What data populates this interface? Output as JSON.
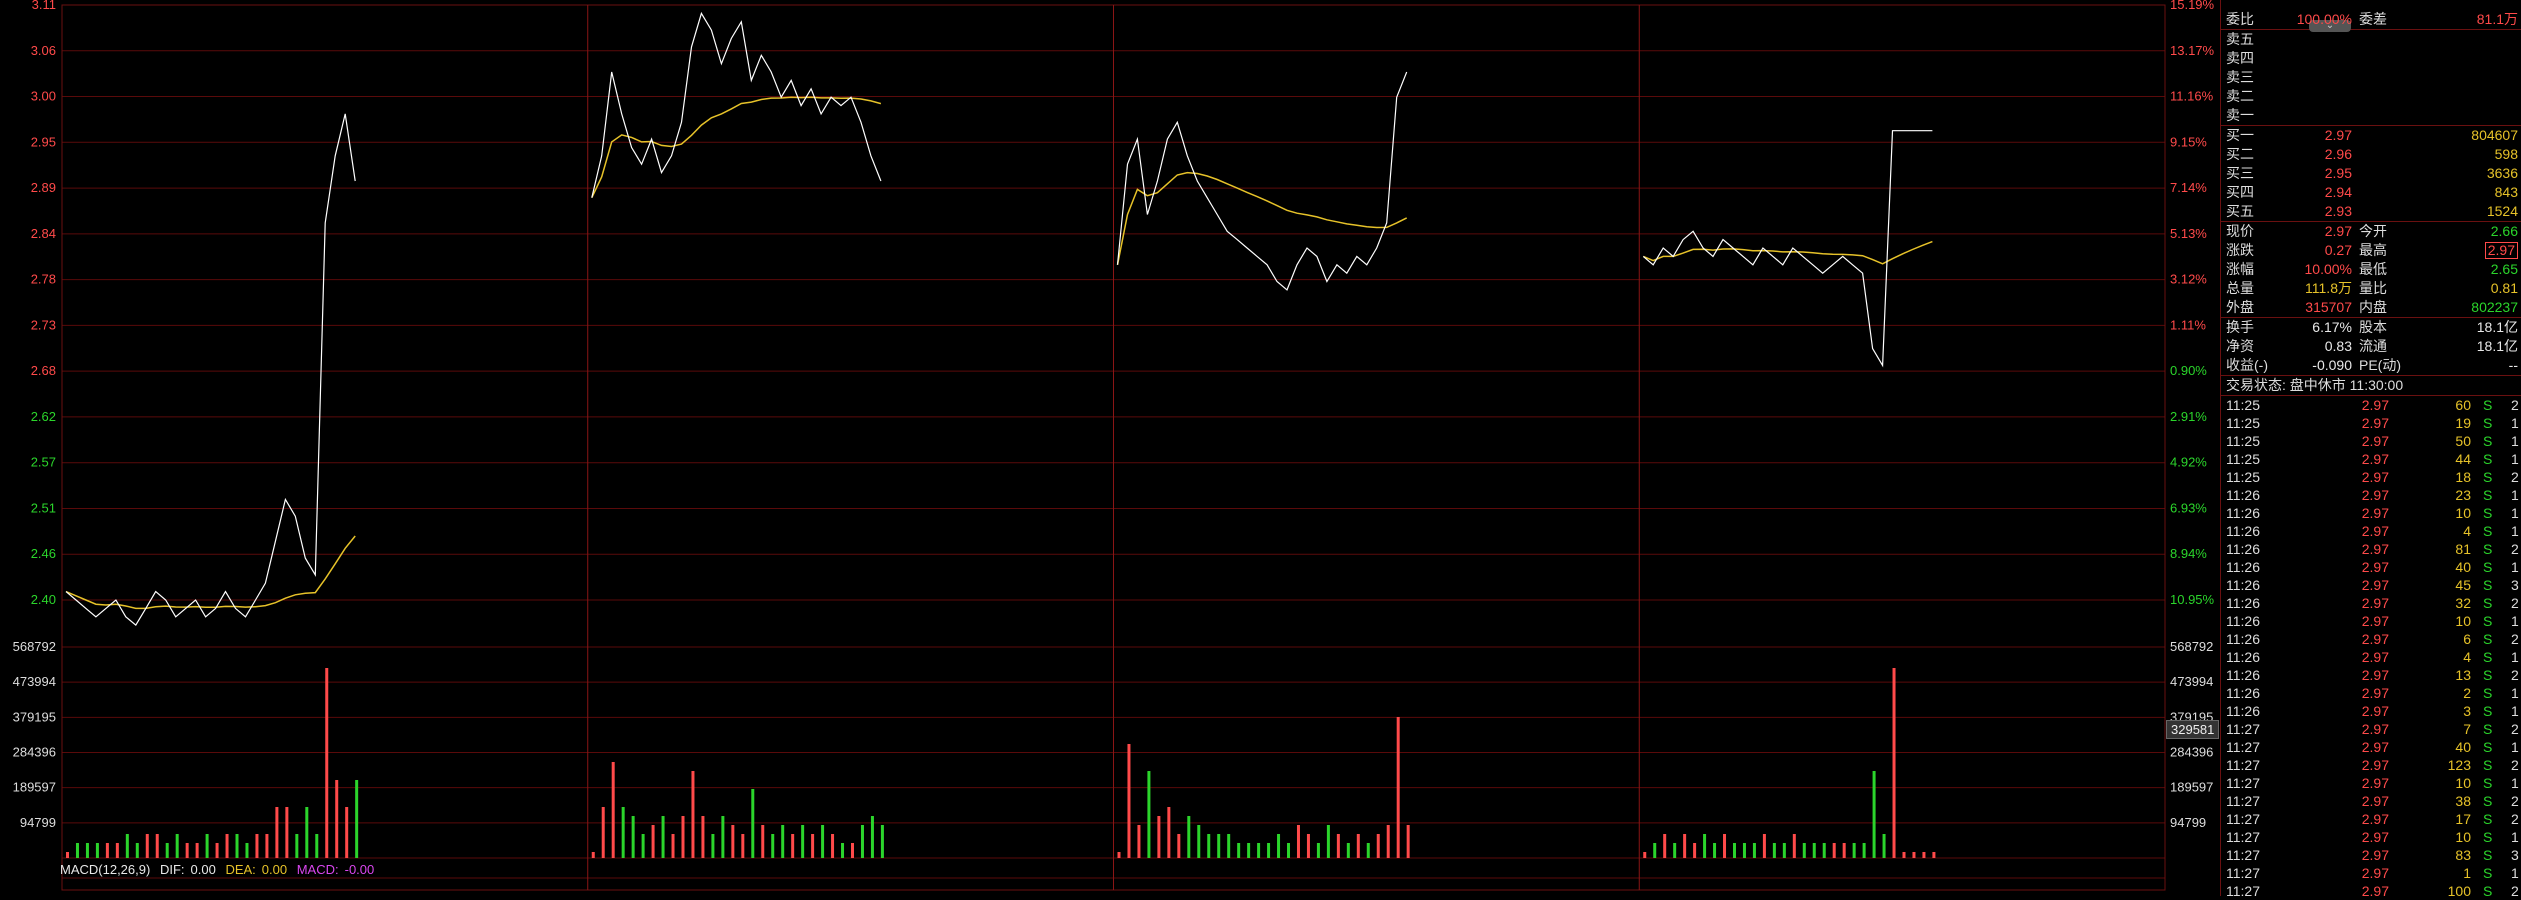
{
  "colors": {
    "up": "#ff4a4a",
    "down": "#2bd52b",
    "price_line": "#ffffff",
    "avg_line": "#e6c229",
    "grid": "#5a0a0a"
  },
  "chart_data": {
    "type": "line",
    "title": "",
    "price_axis_ticks": [
      "3.11",
      "3.06",
      "3.00",
      "2.95",
      "2.89",
      "2.84",
      "2.78",
      "2.73",
      "2.68",
      "2.62",
      "2.57",
      "2.51",
      "2.46",
      "2.40"
    ],
    "pct_axis_ticks": [
      "15.19%",
      "13.17%",
      "11.16%",
      "9.15%",
      "7.14%",
      "5.13%",
      "3.12%",
      "1.11%",
      "0.90%",
      "2.91%",
      "4.92%",
      "6.93%",
      "8.94%",
      "10.95%"
    ],
    "volume_axis_ticks": [
      "568792",
      "473994",
      "379195",
      "284396",
      "189597",
      "94799"
    ],
    "volume_tag": "329581",
    "ylim": [
      2.4,
      3.11
    ],
    "days": [
      {
        "price": [
          2.41,
          2.4,
          2.39,
          2.38,
          2.39,
          2.4,
          2.38,
          2.37,
          2.39,
          2.41,
          2.4,
          2.38,
          2.39,
          2.4,
          2.38,
          2.39,
          2.41,
          2.39,
          2.38,
          2.4,
          2.42,
          2.47,
          2.52,
          2.5,
          2.45,
          2.43,
          2.85,
          2.93,
          2.98,
          2.9
        ]
      },
      {
        "price": [
          2.88,
          2.93,
          3.03,
          2.98,
          2.94,
          2.92,
          2.95,
          2.91,
          2.93,
          2.97,
          3.06,
          3.1,
          3.08,
          3.04,
          3.07,
          3.09,
          3.02,
          3.05,
          3.03,
          3.0,
          3.02,
          2.99,
          3.01,
          2.98,
          3.0,
          2.99,
          3.0,
          2.97,
          2.93,
          2.9
        ]
      },
      {
        "price": [
          2.8,
          2.92,
          2.95,
          2.86,
          2.9,
          2.95,
          2.97,
          2.93,
          2.9,
          2.88,
          2.86,
          2.84,
          2.83,
          2.82,
          2.81,
          2.8,
          2.78,
          2.77,
          2.8,
          2.82,
          2.81,
          2.78,
          2.8,
          2.79,
          2.81,
          2.8,
          2.82,
          2.85,
          3.0,
          3.03
        ]
      },
      {
        "price": [
          2.81,
          2.8,
          2.82,
          2.81,
          2.83,
          2.84,
          2.82,
          2.81,
          2.83,
          2.82,
          2.81,
          2.8,
          2.82,
          2.81,
          2.8,
          2.82,
          2.81,
          2.8,
          2.79,
          2.8,
          2.81,
          2.8,
          2.79,
          2.7,
          2.68,
          2.96,
          2.96,
          2.96,
          2.96,
          2.96
        ]
      }
    ],
    "macd": {
      "label": "MACD(12,26,9)",
      "dif_label": "DIF:",
      "dif": "0.00",
      "dea_label": "DEA:",
      "dea": "0.00",
      "macd_label": "MACD:",
      "macd": "-0.00"
    }
  },
  "panel": {
    "header": {
      "weibi_label": "委比",
      "weibi": "100.00%",
      "weicha_label": "委差",
      "weicha": "81.1万"
    },
    "asks": [
      {
        "label": "卖五",
        "price": "",
        "vol": ""
      },
      {
        "label": "卖四",
        "price": "",
        "vol": ""
      },
      {
        "label": "卖三",
        "price": "",
        "vol": ""
      },
      {
        "label": "卖二",
        "price": "",
        "vol": ""
      },
      {
        "label": "卖一",
        "price": "",
        "vol": ""
      }
    ],
    "bids": [
      {
        "label": "买一",
        "price": "2.97",
        "vol": "804607"
      },
      {
        "label": "买二",
        "price": "2.96",
        "vol": "598"
      },
      {
        "label": "买三",
        "price": "2.95",
        "vol": "3636"
      },
      {
        "label": "买四",
        "price": "2.94",
        "vol": "843"
      },
      {
        "label": "买五",
        "price": "2.93",
        "vol": "1524"
      }
    ],
    "quote": [
      {
        "l1": "现价",
        "v1": "2.97",
        "l2": "今开",
        "v2": "2.66",
        "c1": "red",
        "c2": "green"
      },
      {
        "l1": "涨跌",
        "v1": "0.27",
        "l2": "最高",
        "v2": "2.97",
        "c1": "red",
        "c2": "red"
      },
      {
        "l1": "涨幅",
        "v1": "10.00%",
        "l2": "最低",
        "v2": "2.65",
        "c1": "red",
        "c2": "green"
      },
      {
        "l1": "总量",
        "v1": "111.8万",
        "l2": "量比",
        "v2": "0.81",
        "c1": "yellow",
        "c2": "yellow"
      },
      {
        "l1": "外盘",
        "v1": "315707",
        "l2": "内盘",
        "v2": "802237",
        "c1": "red",
        "c2": "green"
      }
    ],
    "stats": [
      {
        "l1": "换手",
        "v1": "6.17%",
        "l2": "股本",
        "v2": "18.1亿"
      },
      {
        "l1": "净资",
        "v1": "0.83",
        "l2": "流通",
        "v2": "18.1亿"
      },
      {
        "l1": "收益(-)",
        "v1": "-0.090",
        "l2": "PE(动)",
        "v2": "--"
      }
    ],
    "status": "交易状态: 盘中休市 11:30:00",
    "ticks": [
      [
        "11:25",
        "2.97",
        "60",
        "S",
        "2"
      ],
      [
        "11:25",
        "2.97",
        "19",
        "S",
        "1"
      ],
      [
        "11:25",
        "2.97",
        "50",
        "S",
        "1"
      ],
      [
        "11:25",
        "2.97",
        "44",
        "S",
        "1"
      ],
      [
        "11:25",
        "2.97",
        "18",
        "S",
        "2"
      ],
      [
        "11:26",
        "2.97",
        "23",
        "S",
        "1"
      ],
      [
        "11:26",
        "2.97",
        "10",
        "S",
        "1"
      ],
      [
        "11:26",
        "2.97",
        "4",
        "S",
        "1"
      ],
      [
        "11:26",
        "2.97",
        "81",
        "S",
        "2"
      ],
      [
        "11:26",
        "2.97",
        "40",
        "S",
        "1"
      ],
      [
        "11:26",
        "2.97",
        "45",
        "S",
        "3"
      ],
      [
        "11:26",
        "2.97",
        "32",
        "S",
        "2"
      ],
      [
        "11:26",
        "2.97",
        "10",
        "S",
        "1"
      ],
      [
        "11:26",
        "2.97",
        "6",
        "S",
        "2"
      ],
      [
        "11:26",
        "2.97",
        "4",
        "S",
        "1"
      ],
      [
        "11:26",
        "2.97",
        "13",
        "S",
        "2"
      ],
      [
        "11:26",
        "2.97",
        "2",
        "S",
        "1"
      ],
      [
        "11:26",
        "2.97",
        "3",
        "S",
        "1"
      ],
      [
        "11:27",
        "2.97",
        "7",
        "S",
        "2"
      ],
      [
        "11:27",
        "2.97",
        "40",
        "S",
        "1"
      ],
      [
        "11:27",
        "2.97",
        "123",
        "S",
        "2"
      ],
      [
        "11:27",
        "2.97",
        "10",
        "S",
        "1"
      ],
      [
        "11:27",
        "2.97",
        "38",
        "S",
        "2"
      ],
      [
        "11:27",
        "2.97",
        "17",
        "S",
        "2"
      ],
      [
        "11:27",
        "2.97",
        "10",
        "S",
        "1"
      ],
      [
        "11:27",
        "2.97",
        "83",
        "S",
        "3"
      ],
      [
        "11:27",
        "2.97",
        "1",
        "S",
        "1"
      ],
      [
        "11:27",
        "2.97",
        "100",
        "S",
        "2"
      ]
    ]
  }
}
